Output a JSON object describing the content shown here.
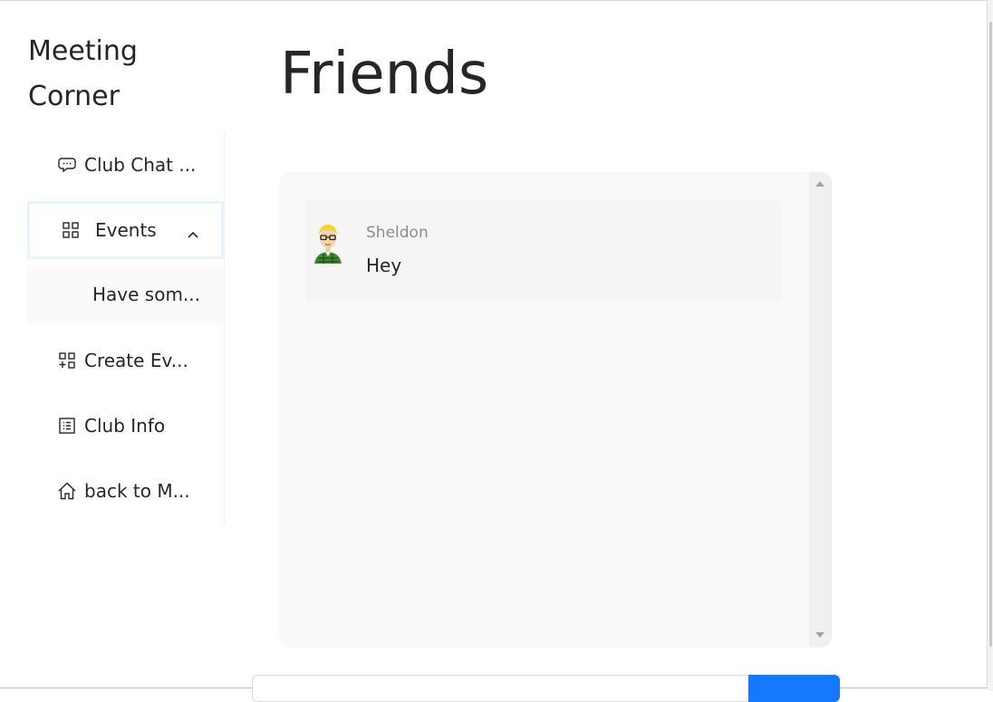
{
  "app": {
    "title": "Meeting Corner"
  },
  "sidebar": {
    "items": [
      {
        "label": "Club Chat ...",
        "icon": "chat-bubbles-icon"
      },
      {
        "label": "Events",
        "icon": "appstore-icon",
        "expanded": true
      },
      {
        "label": "Have som...",
        "icon": null,
        "submenu": true
      },
      {
        "label": "Create Ev...",
        "icon": "appstore-add-icon"
      },
      {
        "label": "Club Info",
        "icon": "list-icon"
      },
      {
        "label": "back to M...",
        "icon": "home-icon"
      }
    ]
  },
  "main": {
    "title": "Friends",
    "messages": [
      {
        "author": "Sheldon",
        "text": "Hey",
        "avatar": "cartoon-avatar"
      }
    ]
  },
  "composer": {
    "value": "",
    "send_label": ""
  },
  "colors": {
    "accent": "#1677ff",
    "panel_bg": "#f9f9f9",
    "focus_ring": "#e6f4ff"
  }
}
